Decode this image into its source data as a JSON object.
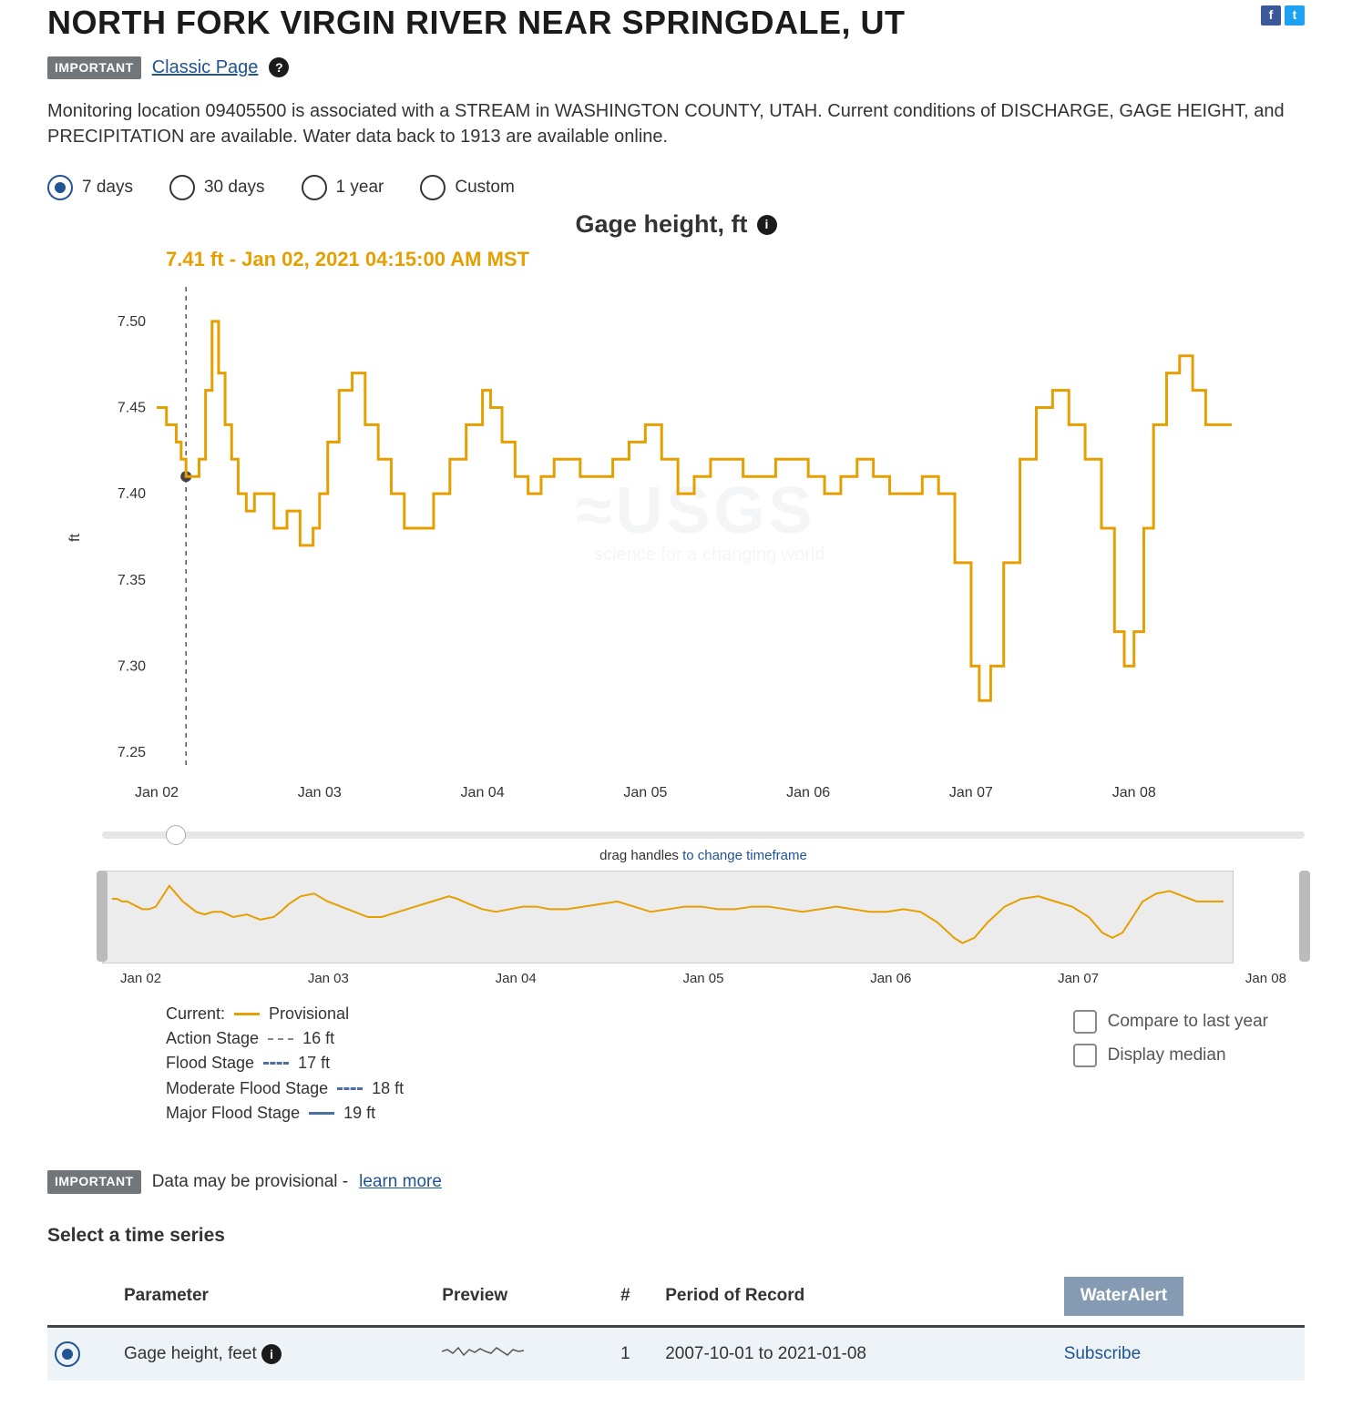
{
  "header": {
    "title": "NORTH FORK VIRGIN RIVER NEAR SPRINGDALE, UT",
    "badge": "IMPORTANT",
    "classic_link": "Classic Page",
    "summary_pre": "Monitoring location 09405500 is associated with a ",
    "summary_stream": "STREAM",
    "summary_mid1": " in ",
    "summary_county": "WASHINGTON COUNTY, UTAH",
    "summary_mid2": ". Current conditions of ",
    "summary_params": "DISCHARGE, GAGE HEIGHT",
    "summary_mid3": ", and ",
    "summary_precip": "PRECIPITATION",
    "summary_tail": " are available. Water data back to 1913 are available online."
  },
  "range_radios": [
    "7 days",
    "30 days",
    "1 year",
    "Custom"
  ],
  "range_selected": "7 days",
  "chart": {
    "title": "Gage height, ft",
    "hover_readout": "7.41 ft - Jan 02, 2021 04:15:00 AM MST",
    "ylabel": "ft",
    "watermark1": "≈USGS",
    "watermark2": "science for a changing world"
  },
  "brush_caption_pre": "drag handles",
  "brush_caption_post": " to change timeframe",
  "legend": {
    "current_label": "Current:",
    "current_value": "Provisional",
    "stages": [
      {
        "label": "Action Stage",
        "value": "16 ft"
      },
      {
        "label": "Flood Stage",
        "value": "17 ft"
      },
      {
        "label": "Moderate Flood Stage",
        "value": "18 ft"
      },
      {
        "label": "Major Flood Stage",
        "value": "19 ft"
      }
    ]
  },
  "toggles": {
    "compare": "Compare to last year",
    "median": "Display median"
  },
  "provisional": {
    "badge": "IMPORTANT",
    "text": "Data may be provisional - ",
    "link": "learn more"
  },
  "ts_section": {
    "heading": "Select a time series",
    "columns": [
      "Parameter",
      "Preview",
      "#",
      "Period of Record",
      "WaterAlert"
    ],
    "row1": {
      "param": "Gage height, feet",
      "count": "1",
      "period": "2007-10-01 to 2021-01-08",
      "alert": "Subscribe"
    }
  },
  "chart_data": {
    "type": "line",
    "title": "Gage height, ft",
    "xlabel": "",
    "ylabel": "ft",
    "ylim": [
      7.24,
      7.52
    ],
    "x_categories": [
      "Jan 02",
      "Jan 03",
      "Jan 04",
      "Jan 05",
      "Jan 06",
      "Jan 07",
      "Jan 08"
    ],
    "hover": {
      "x": 0.18,
      "y": 7.41,
      "label": "7.41 ft - Jan 02, 2021 04:15:00 AM MST"
    },
    "series": [
      {
        "name": "Provisional",
        "color": "#e69f00",
        "step": true,
        "x": [
          0.0,
          0.03,
          0.06,
          0.09,
          0.12,
          0.15,
          0.18,
          0.22,
          0.26,
          0.3,
          0.34,
          0.38,
          0.42,
          0.46,
          0.5,
          0.55,
          0.6,
          0.65,
          0.72,
          0.8,
          0.88,
          0.96,
          1.0,
          1.05,
          1.12,
          1.2,
          1.28,
          1.36,
          1.44,
          1.52,
          1.6,
          1.7,
          1.8,
          1.9,
          2.0,
          2.05,
          2.12,
          2.2,
          2.28,
          2.36,
          2.44,
          2.52,
          2.6,
          2.7,
          2.8,
          2.9,
          3.0,
          3.1,
          3.2,
          3.3,
          3.4,
          3.5,
          3.6,
          3.7,
          3.8,
          3.9,
          4.0,
          4.1,
          4.2,
          4.3,
          4.4,
          4.5,
          4.6,
          4.7,
          4.8,
          4.9,
          5.0,
          5.05,
          5.12,
          5.2,
          5.3,
          5.4,
          5.5,
          5.6,
          5.7,
          5.8,
          5.88,
          5.94,
          6.0,
          6.06,
          6.12,
          6.2,
          6.28,
          6.36,
          6.44,
          6.52,
          6.6
        ],
        "y": [
          7.45,
          7.45,
          7.44,
          7.44,
          7.43,
          7.42,
          7.41,
          7.41,
          7.42,
          7.46,
          7.5,
          7.47,
          7.44,
          7.42,
          7.4,
          7.39,
          7.4,
          7.4,
          7.38,
          7.39,
          7.37,
          7.38,
          7.4,
          7.43,
          7.46,
          7.47,
          7.44,
          7.42,
          7.4,
          7.38,
          7.38,
          7.4,
          7.42,
          7.44,
          7.46,
          7.45,
          7.43,
          7.41,
          7.4,
          7.41,
          7.42,
          7.42,
          7.41,
          7.41,
          7.42,
          7.43,
          7.44,
          7.42,
          7.4,
          7.41,
          7.42,
          7.42,
          7.41,
          7.41,
          7.42,
          7.42,
          7.41,
          7.4,
          7.41,
          7.42,
          7.41,
          7.4,
          7.4,
          7.41,
          7.4,
          7.36,
          7.3,
          7.28,
          7.3,
          7.36,
          7.42,
          7.45,
          7.46,
          7.44,
          7.42,
          7.38,
          7.32,
          7.3,
          7.32,
          7.38,
          7.44,
          7.47,
          7.48,
          7.46,
          7.44,
          7.44,
          7.44
        ]
      }
    ],
    "mini_x_categories": [
      "Jan 02",
      "Jan 03",
      "Jan 04",
      "Jan 05",
      "Jan 06",
      "Jan 07",
      "Jan 08"
    ]
  }
}
